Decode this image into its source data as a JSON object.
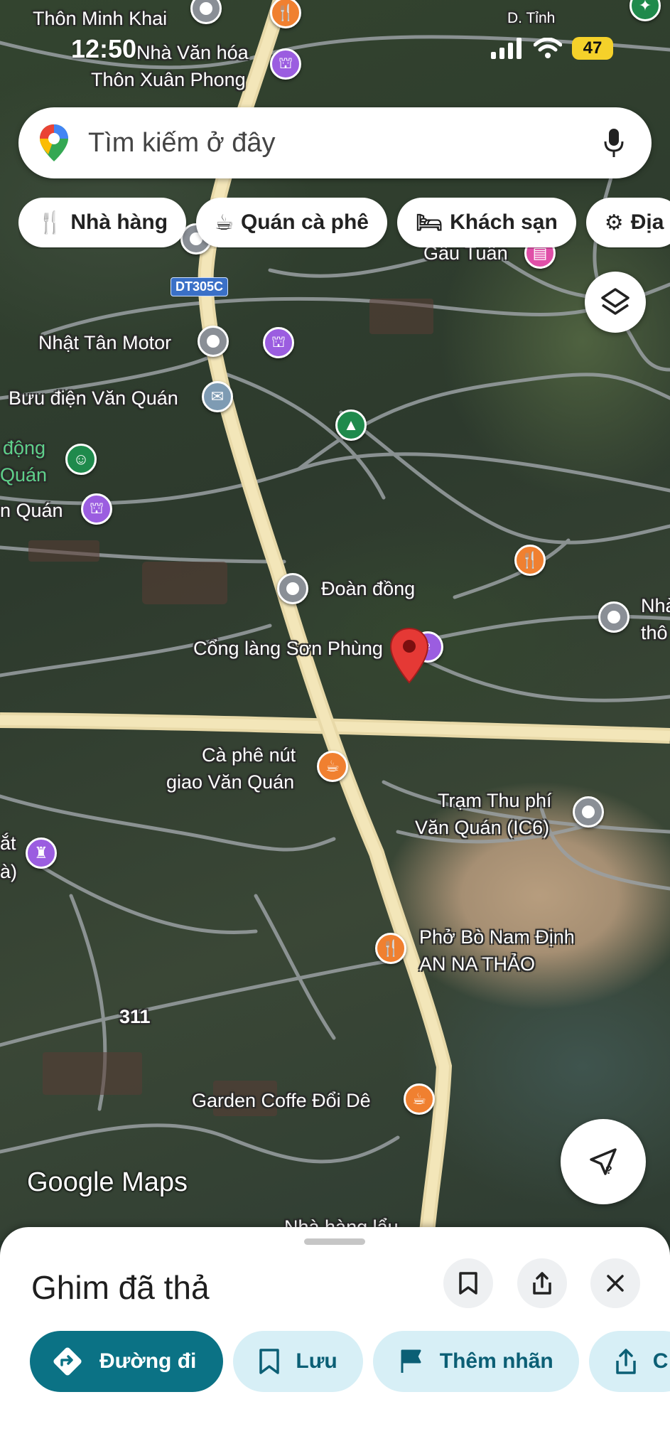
{
  "status_bar": {
    "time": "12:50",
    "battery": "47"
  },
  "search": {
    "placeholder": "Tìm kiếm ở đây"
  },
  "chips": [
    {
      "label": "Nhà hàng",
      "icon": "restaurant-icon"
    },
    {
      "label": "Quán cà phê",
      "icon": "coffee-icon"
    },
    {
      "label": "Khách sạn",
      "icon": "hotel-icon"
    },
    {
      "label": "Địa",
      "icon": "attraction-icon"
    }
  ],
  "map_labels": {
    "thon_minh_khai": "Thôn Minh Khai",
    "nha_van_hoa": "Nhà Văn hóa",
    "thon_xuan_phong": "Thôn Xuân Phong",
    "d_tinh": "D. Tỉnh",
    "gau_tuan": "Gấu Tuấn",
    "route_dt305c": "DT305C",
    "nhat_tan_motor": "Nhật Tân Motor",
    "buu_dien": "Bưu điện Văn Quán",
    "dong": "động",
    "quan": "Quán",
    "n_quan": "n Quán",
    "doan_dong": "Đoàn đồng",
    "nha_right": "Nhà",
    "tho_right": "thô",
    "cong_lang": "Cổng làng Sơn Phùng",
    "ca_phe_1": "Cà phê nút",
    "ca_phe_2": "giao Văn Quán",
    "tram_1": "Trạm Thu phí",
    "tram_2": "Văn Quán (IC6)",
    "at": "ắt",
    "a_paren": "à)",
    "pho_1": "Phở Bò Nam Định",
    "pho_2": "AN NA THẢO",
    "route_311": "311",
    "garden": "Garden Coffe Đổi Dê",
    "nha_hang_bottom": "Nhà hàng lẩu"
  },
  "branding": {
    "google_maps": "Google Maps"
  },
  "sheet": {
    "title": "Ghim đã thả",
    "actions": [
      {
        "label": "Đường đi",
        "icon": "directions-icon"
      },
      {
        "label": "Lưu",
        "icon": "bookmark-icon"
      },
      {
        "label": "Thêm nhãn",
        "icon": "flag-icon"
      },
      {
        "label": "C",
        "icon": "share-icon"
      }
    ]
  },
  "colors": {
    "accent": "#0b7285",
    "chip_bg": "#d7eff6",
    "pin_red": "#e53935"
  }
}
